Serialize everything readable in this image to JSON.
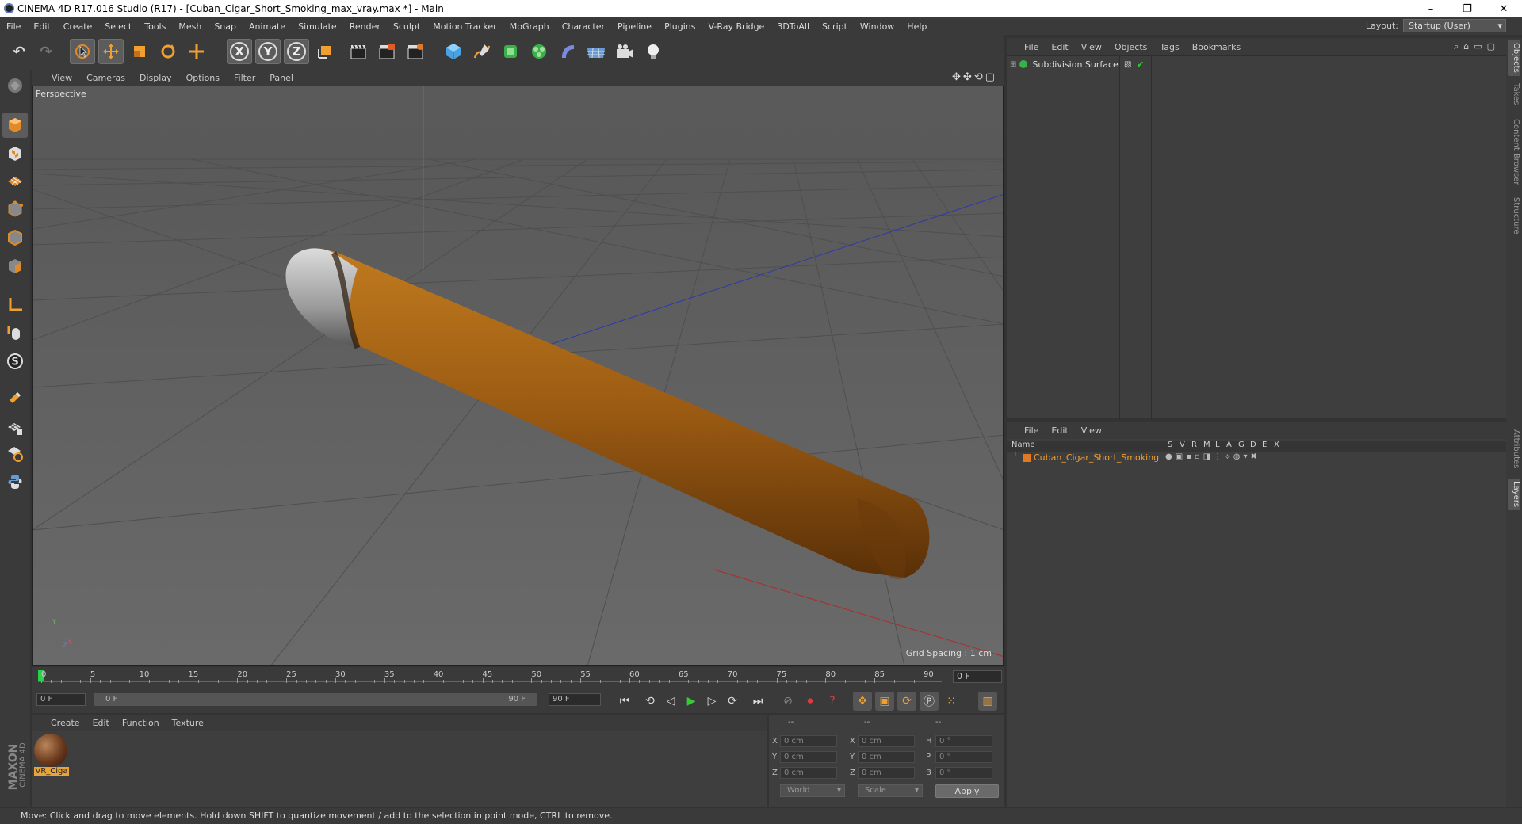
{
  "window": {
    "title": "CINEMA 4D R17.016 Studio (R17) - [Cuban_Cigar_Short_Smoking_max_vray.max *] - Main",
    "min_glyph": "–",
    "max_glyph": "❐",
    "close_glyph": "✕"
  },
  "menubar": {
    "items": [
      "File",
      "Edit",
      "Create",
      "Select",
      "Tools",
      "Mesh",
      "Snap",
      "Animate",
      "Simulate",
      "Render",
      "Sculpt",
      "Motion Tracker",
      "MoGraph",
      "Character",
      "Pipeline",
      "Plugins",
      "V-Ray Bridge",
      "3DToAll",
      "Script",
      "Window",
      "Help"
    ],
    "layout_label": "Layout:",
    "layout_value": "Startup (User)"
  },
  "toolbar": {
    "undo_glyph": "↶",
    "redo_glyph": "↷",
    "x_label": "X",
    "y_label": "Y",
    "z_label": "Z"
  },
  "viewport": {
    "menu": [
      "View",
      "Cameras",
      "Display",
      "Options",
      "Filter",
      "Panel"
    ],
    "camera_label": "Perspective",
    "grid_spacing": "Grid Spacing : 1 cm",
    "axis_labels": {
      "y": "Y",
      "x": "X",
      "z": "Z"
    }
  },
  "timeline": {
    "ticks": [
      "0",
      "5",
      "10",
      "15",
      "20",
      "25",
      "30",
      "35",
      "40",
      "45",
      "50",
      "55",
      "60",
      "65",
      "70",
      "75",
      "80",
      "85",
      "90"
    ],
    "current_frame": "0 F",
    "start_field": "0 F",
    "range_start": "0 F",
    "range_end": "90 F",
    "end_field": "90 F"
  },
  "material_manager": {
    "menu": [
      "Create",
      "Edit",
      "Function",
      "Texture"
    ],
    "materials": [
      {
        "name": "VR_Ciga"
      }
    ]
  },
  "coordinates": {
    "headers": [
      "--",
      "--",
      "--"
    ],
    "rows": [
      {
        "a": "X",
        "av": "0 cm",
        "b": "X",
        "bv": "0 cm",
        "c": "H",
        "cv": "0 °"
      },
      {
        "a": "Y",
        "av": "0 cm",
        "b": "Y",
        "bv": "0 cm",
        "c": "P",
        "cv": "0 °"
      },
      {
        "a": "Z",
        "av": "0 cm",
        "b": "Z",
        "bv": "0 cm",
        "c": "B",
        "cv": "0 °"
      }
    ],
    "mode_world": "World",
    "mode_scale": "Scale",
    "apply_label": "Apply"
  },
  "object_manager": {
    "menu": [
      "File",
      "Edit",
      "View",
      "Objects",
      "Tags",
      "Bookmarks"
    ],
    "objects": [
      {
        "name": "Subdivision Surface"
      }
    ]
  },
  "layer_manager": {
    "menu": [
      "File",
      "Edit",
      "View"
    ],
    "columns": [
      "Name",
      "S",
      "V",
      "R",
      "M",
      "L",
      "A",
      "G",
      "D",
      "E",
      "X"
    ],
    "layers": [
      {
        "name": "Cuban_Cigar_Short_Smoking",
        "color": "#e07a20"
      }
    ]
  },
  "side_tabs": [
    "Objects",
    "Takes",
    "Content Browser",
    "Structure",
    "Attributes",
    "Layers"
  ],
  "brand": {
    "line1": "MAXON",
    "line2": "CINEMA 4D"
  },
  "status": "Move: Click and drag to move elements. Hold down SHIFT to quantize movement / add to the selection in point mode, CTRL to remove.",
  "colors": {
    "accent_orange": "#e8a33a",
    "selected_tool": "#5c5c5c",
    "viewport_bg": "#5e5e5e"
  }
}
